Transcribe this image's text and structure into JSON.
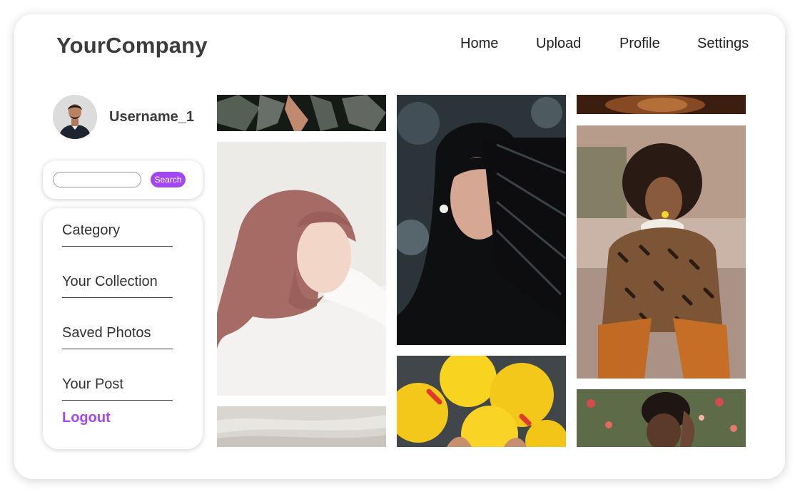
{
  "header": {
    "brand": "YourCompany",
    "nav": [
      "Home",
      "Upload",
      "Profile",
      "Settings"
    ]
  },
  "user": {
    "username": "Username_1"
  },
  "search": {
    "button_label": "Search",
    "value": "",
    "placeholder": ""
  },
  "menu": {
    "items": [
      "Category",
      "Your Collection",
      "Saved Photos",
      "Your Post"
    ],
    "logout": "Logout"
  },
  "colors": {
    "accent": "#a347f5",
    "text": "#3b3b3b",
    "background": "#ffffff"
  },
  "gallery": {
    "photos": [
      "dark-floral-dress-photo",
      "woman-in-pink-hijab-photo",
      "white-fabric-photo",
      "woman-with-black-fan-photo",
      "yellow-emoji-balloons-photo",
      "warm-brown-photo",
      "woman-in-leopard-coat-photo",
      "woman-by-flowers-photo"
    ]
  }
}
